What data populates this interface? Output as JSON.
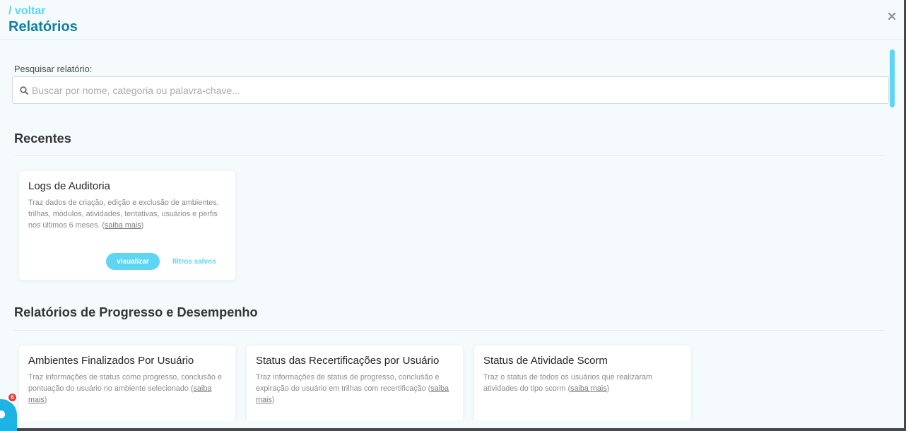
{
  "header": {
    "back_label": "/ voltar",
    "title": "Relatórios",
    "close_icon": "close-icon"
  },
  "search": {
    "label": "Pesquisar relatório:",
    "placeholder": "Buscar por nome, categoria ou palavra-chave...",
    "value": "",
    "icon": "search-icon"
  },
  "ui": {
    "paren_open": "(",
    "paren_close": ")"
  },
  "sections": [
    {
      "title": "Recentes",
      "cards": [
        {
          "title": "Logs de Auditoria",
          "description": "Traz dados de criação, edição e exclusão de ambientes, trilhas, módulos, atividades, tentativas, usuários e perfis nos últimos 6 meses.",
          "more_link": "saiba mais",
          "view_button": "visualizar",
          "saved_filters_link": "filtros salvos"
        }
      ]
    },
    {
      "title": "Relatórios de Progresso e Desempenho",
      "cards": [
        {
          "title": "Ambientes Finalizados Por Usuário",
          "description": "Traz informações de status como progresso, conclusão e pontuação do usuário no ambiente selecionado",
          "more_link": "saiba mais"
        },
        {
          "title": "Status das Recertificações por Usuário",
          "description": "Traz informações de status de progresso, conclusão e expiração do usuário em trilhas com recertificação",
          "more_link": "saiba mais"
        },
        {
          "title": "Status de Atividade Scorm",
          "description": "Traz o status de todos os usuários que realizaram atividades do tipo scorm",
          "more_link": "saiba mais"
        }
      ]
    }
  ],
  "scrollbar": {
    "scroll_percent": 0
  },
  "chat_widget": {
    "icon": "chat-icon",
    "badge_count": "6"
  },
  "colors": {
    "accent": "#5dd5f3",
    "brand": "#0f7fa3",
    "badge": "#e53935",
    "chat": "#1db3e5"
  }
}
